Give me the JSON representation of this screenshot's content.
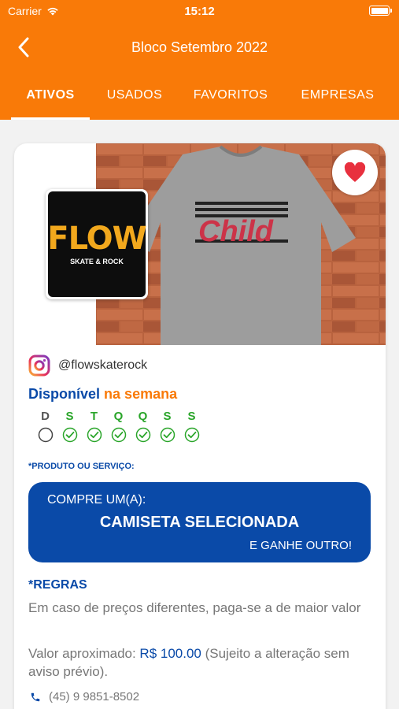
{
  "status": {
    "carrier": "Carrier",
    "time": "15:12"
  },
  "nav": {
    "title": "Bloco Setembro 2022"
  },
  "tabs": [
    {
      "label": "ATIVOS",
      "active": true
    },
    {
      "label": "USADOS",
      "active": false
    },
    {
      "label": "FAVORITOS",
      "active": false
    },
    {
      "label": "EMPRESAS",
      "active": false
    }
  ],
  "product": {
    "shirt_text": "Child",
    "logo_title": "FLOW",
    "logo_subtitle": "SKATE & ROCK",
    "instagram": "@flowskaterock",
    "availability_1": "Disponível",
    "availability_2": "na semana",
    "days": [
      {
        "letter": "D",
        "checked": false
      },
      {
        "letter": "S",
        "checked": true
      },
      {
        "letter": "T",
        "checked": true
      },
      {
        "letter": "Q",
        "checked": true
      },
      {
        "letter": "Q",
        "checked": true
      },
      {
        "letter": "S",
        "checked": true
      },
      {
        "letter": "S",
        "checked": true
      }
    ],
    "product_label": "*PRODUTO OU SERVIÇO:",
    "banner_line1": "COMPRE UM(A):",
    "banner_line2": "CAMISETA SELECIONADA",
    "banner_line3": "E GANHE OUTRO!",
    "rules_title": "*REGRAS",
    "rules_text": "Em caso de preços diferentes, paga-se a de maior valor",
    "value_prefix": "Valor aproximado: ",
    "value_price": "R$ 100.00",
    "value_suffix": " (Sujeito a alteração sem aviso prévio).",
    "phone": "(45) 9 9851-8502"
  },
  "colors": {
    "accent": "#f97a08",
    "primary": "#0a4aa8",
    "check": "#2aa52a"
  }
}
